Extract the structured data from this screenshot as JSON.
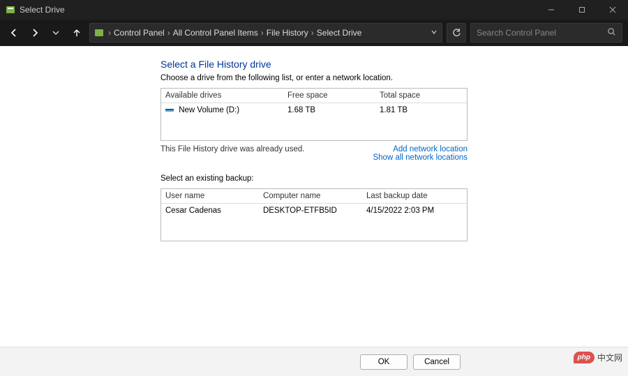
{
  "window": {
    "title": "Select Drive"
  },
  "breadcrumbs": [
    "Control Panel",
    "All Control Panel Items",
    "File History",
    "Select Drive"
  ],
  "search": {
    "placeholder": "Search Control Panel"
  },
  "page": {
    "heading": "Select a File History drive",
    "instruction": "Choose a drive from the following list, or enter a network location."
  },
  "drives_table": {
    "headers": {
      "a": "Available drives",
      "b": "Free space",
      "c": "Total space"
    },
    "rows": [
      {
        "name": "New Volume (D:)",
        "free": "1.68 TB",
        "total": "1.81 TB"
      }
    ]
  },
  "status_msg": "This File History drive was already used.",
  "links": {
    "add": "Add network location",
    "show_all": "Show all network locations"
  },
  "backup_section_label": "Select an existing backup:",
  "backup_table": {
    "headers": {
      "a": "User name",
      "b": "Computer name",
      "c": "Last backup date"
    },
    "rows": [
      {
        "user": "Cesar Cadenas",
        "computer": "DESKTOP-ETFB5ID",
        "date": "4/15/2022 2:03 PM"
      }
    ]
  },
  "buttons": {
    "ok": "OK",
    "cancel": "Cancel"
  },
  "watermark": {
    "badge": "php",
    "text": "中文网"
  }
}
